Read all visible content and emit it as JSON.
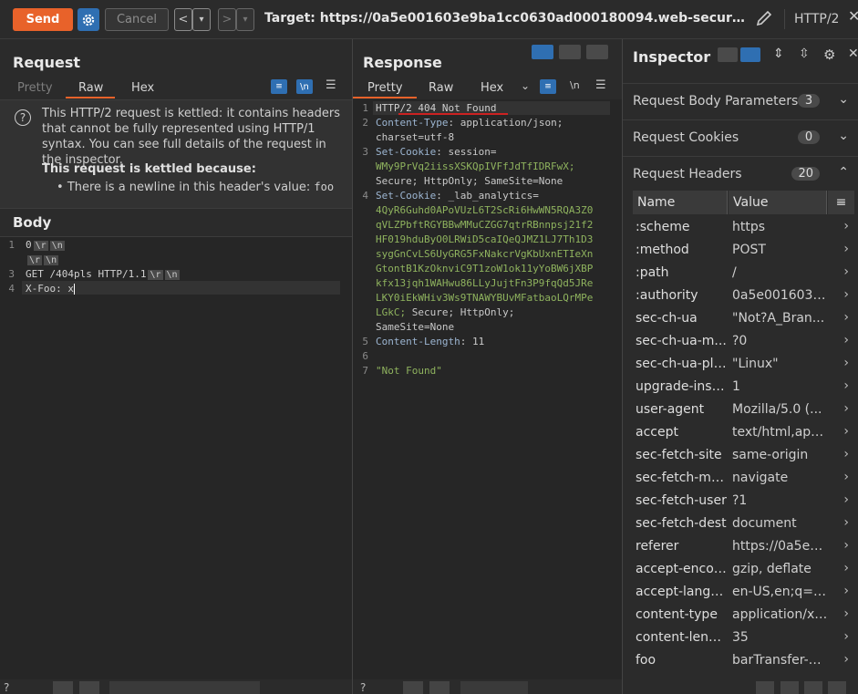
{
  "toolbar": {
    "send": "Send",
    "cancel": "Cancel",
    "back": "<",
    "forward": ">",
    "dropdown": "▾",
    "target": "Target: https://0a5e001603e9ba1cc0630ad000180094.web-security-academy....",
    "protocol": "HTTP/2"
  },
  "request": {
    "title": "Request",
    "tabs": [
      "Pretty",
      "Raw",
      "Hex"
    ],
    "active_tab": "Raw",
    "wrap_label": "\\n",
    "info_text": "This HTTP/2 request is kettled: it contains headers that cannot be fully represented using HTTP/1 syntax. You can see full details of the request in the inspector.",
    "info_bold": "This request is kettled because:",
    "info_bullet_prefix": "There is a newline in this header's value: ",
    "info_bullet_code": "foo",
    "body_title": "Body",
    "body_lines": [
      {
        "n": "1",
        "text": "0"
      },
      {
        "n": "",
        "text": ""
      },
      {
        "n": "3",
        "text": "GET /404pls HTTP/1.1"
      },
      {
        "n": "4",
        "text": "X-Foo: x"
      }
    ],
    "crlf": "\\r",
    "lf": "\\n"
  },
  "response": {
    "title": "Response",
    "tabs": [
      "Pretty",
      "Raw",
      "Hex"
    ],
    "active_tab": "Pretty",
    "wrap_label": "\\n",
    "line_numbers": [
      "1",
      "2",
      "",
      "3",
      "",
      "",
      "4",
      "",
      "",
      "",
      "",
      "",
      "",
      "",
      "",
      "",
      "5",
      "6",
      "7"
    ],
    "status_line_prefix": "HTTP/2 ",
    "status_code": "404 Not Found",
    "content_type_name": "Content-Type",
    "content_type_value": "application/json;",
    "content_type_value2": "charset=utf-8",
    "set_cookie_name": "Set-Cookie",
    "session_key": "session=",
    "session_value": "WMy9PrVq2iissXSKQpIVFfJdTfIDRFwX;",
    "cookie_flags_1": "Secure; HttpOnly; SameSite=None",
    "lab_key": "_lab_analytics=",
    "lab_lines": [
      "4QyR6Guhd0APoVUzL6T2ScRi6HwWN5RQA3Z0",
      "qVLZPbftRGYBBwMMuCZGG7qtrRBnnpsj21f2",
      "HF019hduByO0LRWiD5caIQeQJMZ1LJ7Th1D3",
      "sygGnCvLS6UyGRG5FxNakcrVgKbUxnETIeXn",
      "GtontB1KzOknviC9T1zoW1ok11yYoBW6jXBP",
      "kfx13jqh1WAHwu86LLyJujtFn3P9fqQd5JRe",
      "LKY0iEkWHiv3Ws9TNAWYBUvMFatbaoLQrMPe",
      "LGkC;"
    ],
    "cookie_flags_2a": " Secure; HttpOnly;",
    "cookie_flags_2b": "SameSite=None",
    "content_length_name": "Content-Length",
    "content_length_value": "11",
    "body": "\"Not Found\""
  },
  "inspector": {
    "title": "Inspector",
    "sections": [
      {
        "label": "Request Body Parameters",
        "count": "3"
      },
      {
        "label": "Request Cookies",
        "count": "0"
      },
      {
        "label": "Request Headers",
        "count": "20"
      }
    ],
    "col_name": "Name",
    "col_value": "Value",
    "headers": [
      {
        "name": ":scheme",
        "value": "https"
      },
      {
        "name": ":method",
        "value": "POST"
      },
      {
        "name": ":path",
        "value": "/"
      },
      {
        "name": ":authority",
        "value": "0a5e001603e..."
      },
      {
        "name": "sec-ch-ua",
        "value": "\"Not?A_Bran..."
      },
      {
        "name": "sec-ch-ua-m...",
        "value": "?0"
      },
      {
        "name": "sec-ch-ua-pla...",
        "value": "\"Linux\""
      },
      {
        "name": "upgrade-inse...",
        "value": "1"
      },
      {
        "name": "user-agent",
        "value": "Mozilla/5.0 (..."
      },
      {
        "name": "accept",
        "value": "text/html,app..."
      },
      {
        "name": "sec-fetch-site",
        "value": "same-origin"
      },
      {
        "name": "sec-fetch-mode",
        "value": "navigate"
      },
      {
        "name": "sec-fetch-user",
        "value": "?1"
      },
      {
        "name": "sec-fetch-dest",
        "value": "document"
      },
      {
        "name": "referer",
        "value": "https://0a5e0..."
      },
      {
        "name": "accept-encodi...",
        "value": "gzip, deflate"
      },
      {
        "name": "accept-langu...",
        "value": "en-US,en;q=0.9"
      },
      {
        "name": "content-type",
        "value": "application/x-..."
      },
      {
        "name": "content-length",
        "value": "35"
      },
      {
        "name": "foo",
        "value": "barTransfer-E..."
      }
    ]
  },
  "colors": {
    "accent": "#e8622a",
    "blue": "#2f6fb2",
    "bg": "#2b2b2b"
  }
}
